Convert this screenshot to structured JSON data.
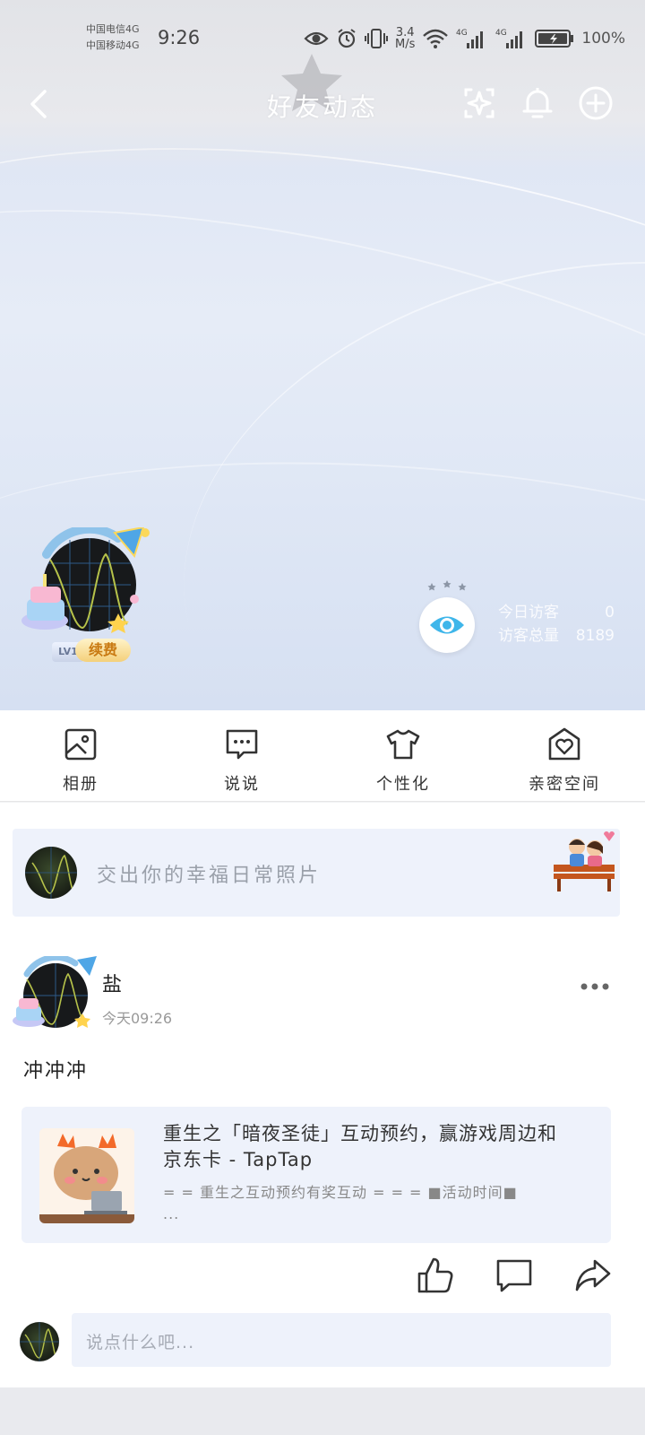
{
  "status_bar": {
    "carrier_1": "中国电信4G",
    "carrier_2": "中国移动4G",
    "time": "9:26",
    "net_speed_value": "3.4",
    "net_speed_unit": "M/s",
    "signal_1_label": "4G",
    "signal_2_label": "4G",
    "battery": "100%"
  },
  "nav": {
    "title": "好友动态",
    "back_icon": "chevron-left-icon",
    "icons": [
      "sparkle-icon",
      "bell-icon",
      "plus-circle-icon"
    ]
  },
  "profile": {
    "level": "LV1",
    "renew_label": "续费",
    "visitors": {
      "today_label": "今日访客",
      "today_value": "0",
      "total_label": "访客总量",
      "total_value": "8189"
    }
  },
  "quick_actions": [
    {
      "label": "相册",
      "icon": "photo-album-icon"
    },
    {
      "label": "说说",
      "icon": "chat-bubble-icon"
    },
    {
      "label": "个性化",
      "icon": "tshirt-icon"
    },
    {
      "label": "亲密空间",
      "icon": "home-heart-icon"
    }
  ],
  "prompt": {
    "placeholder": "交出你的幸福日常照片"
  },
  "post": {
    "author": "盐",
    "time": "今天09:26",
    "text": "冲冲冲",
    "link": {
      "title": "重生之「暗夜圣徒」互动预约，赢游戏周边和京东卡 - TapTap",
      "desc": "= = 重生之互动预约有奖互动 = = = ■活动时间■ ..."
    }
  },
  "comment": {
    "placeholder": "说点什么吧..."
  },
  "colors": {
    "accent_blue": "#3fb6ea",
    "card_bg": "#eef2fb",
    "renew_gold": "#c97a12"
  }
}
